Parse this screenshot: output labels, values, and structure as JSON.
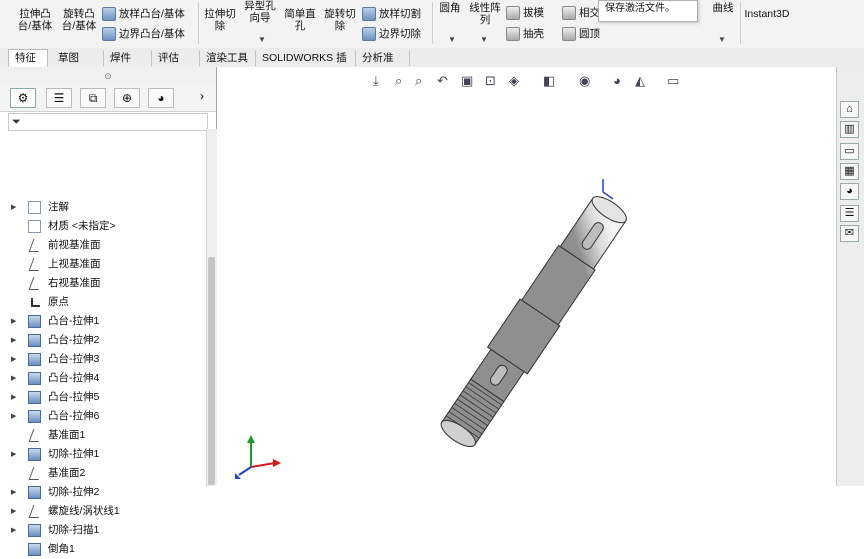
{
  "ribbon": {
    "extrude_boss_line1": "拉伸凸",
    "extrude_boss_line2": "台/基体",
    "revolve_boss_line1": "旋转凸",
    "revolve_boss_line2": "台/基体",
    "sweep_boss": "扫描",
    "loft_boss": "放样凸台/基体",
    "boundary_boss": "边界凸台/基体",
    "extrude_cut_line1": "拉伸切",
    "extrude_cut_line2": "除",
    "hole_wizard_line1": "异型孔",
    "hole_wizard_line2": "向导",
    "simple_hole_line1": "简单直",
    "simple_hole_line2": "孔",
    "revolve_cut_line1": "旋转切",
    "revolve_cut_line2": "除",
    "loft_cut": "放样切割",
    "boundary_cut": "边界切除",
    "fillet": "圆角",
    "linear_pattern_line1": "线性阵",
    "linear_pattern_line2": "列",
    "draft": "拔模",
    "shell": "抽壳",
    "intersect": "相交",
    "dome": "圆顶",
    "curves": "曲线",
    "instant3d": "Instant3D"
  },
  "tooltip_text": "保存激活文件。",
  "command_tabs": [
    "特征",
    "草图",
    "焊件",
    "评估",
    "渲染工具",
    "SOLIDWORKS 插件",
    "分析准备"
  ],
  "active_tab": "特征",
  "filter_icon": "funnel-icon",
  "tree": [
    {
      "label": "注解",
      "icon": "annotation-icon",
      "expandable": true
    },
    {
      "label": "材质 <未指定>",
      "icon": "material-icon",
      "expandable": false
    },
    {
      "label": "前视基准面",
      "icon": "plane-icon",
      "expandable": false
    },
    {
      "label": "上视基准面",
      "icon": "plane-icon",
      "expandable": false
    },
    {
      "label": "右视基准面",
      "icon": "plane-icon",
      "expandable": false
    },
    {
      "label": "原点",
      "icon": "origin-icon",
      "expandable": false
    },
    {
      "label": "凸台-拉伸1",
      "icon": "boss-extrude-icon",
      "expandable": true
    },
    {
      "label": "凸台-拉伸2",
      "icon": "boss-extrude-icon",
      "expandable": true
    },
    {
      "label": "凸台-拉伸3",
      "icon": "boss-extrude-icon",
      "expandable": true
    },
    {
      "label": "凸台-拉伸4",
      "icon": "boss-extrude-icon",
      "expandable": true
    },
    {
      "label": "凸台-拉伸5",
      "icon": "boss-extrude-icon",
      "expandable": true
    },
    {
      "label": "凸台-拉伸6",
      "icon": "boss-extrude-icon",
      "expandable": true
    },
    {
      "label": "基准面1",
      "icon": "plane-icon",
      "expandable": false
    },
    {
      "label": "切除-拉伸1",
      "icon": "cut-extrude-icon",
      "expandable": true
    },
    {
      "label": "基准面2",
      "icon": "plane-icon",
      "expandable": false
    },
    {
      "label": "切除-拉伸2",
      "icon": "cut-extrude-icon",
      "expandable": true
    },
    {
      "label": "螺旋线/涡状线1",
      "icon": "helix-icon",
      "expandable": true
    },
    {
      "label": "切除-扫描1",
      "icon": "cut-sweep-icon",
      "expandable": true
    },
    {
      "label": "倒角1",
      "icon": "chamfer-icon",
      "expandable": false
    }
  ],
  "colors": {
    "ribbon_bg": "#f3f3f3",
    "tab_bg": "#ececec",
    "axis_x": "#d11a1a",
    "axis_y": "#1f9a2a",
    "axis_z": "#2244cc"
  }
}
